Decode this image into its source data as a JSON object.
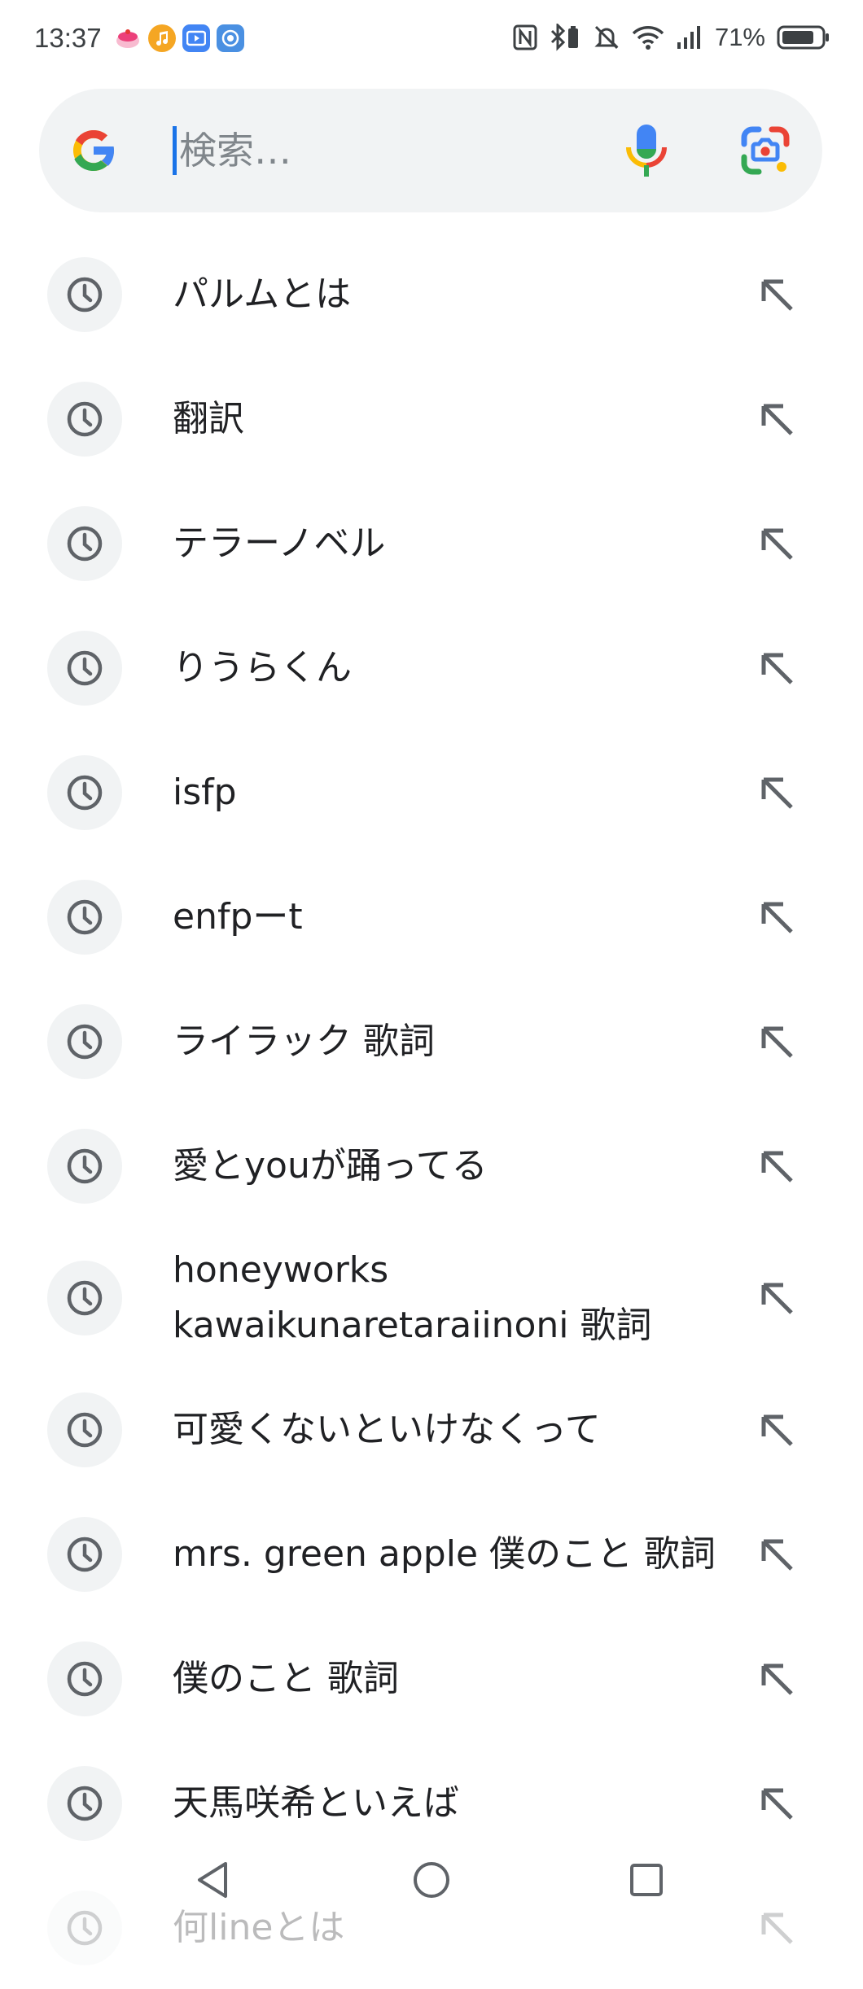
{
  "status_bar": {
    "time": "13:37",
    "battery": "71%",
    "app_icons": [
      "cake-app-icon",
      "music-app-icon",
      "video-app-icon",
      "browser-app-icon"
    ],
    "system_icons": [
      "nfc-icon",
      "bluetooth-icon",
      "mute-icon",
      "wifi-icon",
      "signal-icon",
      "battery-icon"
    ]
  },
  "search": {
    "placeholder": "検索…",
    "value": ""
  },
  "colors": {
    "google_blue": "#4285F4",
    "google_red": "#EA4335",
    "google_yellow": "#FBBC05",
    "google_green": "#34A853",
    "pill_bg": "#f1f3f4",
    "icon_gray": "#5f6368"
  },
  "suggestions": [
    {
      "text": "パルムとは"
    },
    {
      "text": "翻訳"
    },
    {
      "text": "テラーノベル"
    },
    {
      "text": "りうらくん"
    },
    {
      "text": "isfp"
    },
    {
      "text": "enfpーt"
    },
    {
      "text": "ライラック 歌詞"
    },
    {
      "text": "愛とyouが踊ってる"
    },
    {
      "line1": "honeyworks",
      "line2": "kawaikunaretaraiinoni 歌詞"
    },
    {
      "text": "可愛くないといけなくって"
    },
    {
      "text": "mrs. green apple 僕のこと 歌詞"
    },
    {
      "text": "僕のこと 歌詞"
    },
    {
      "text": "天馬咲希といえば"
    },
    {
      "text": "何lineとは"
    }
  ]
}
